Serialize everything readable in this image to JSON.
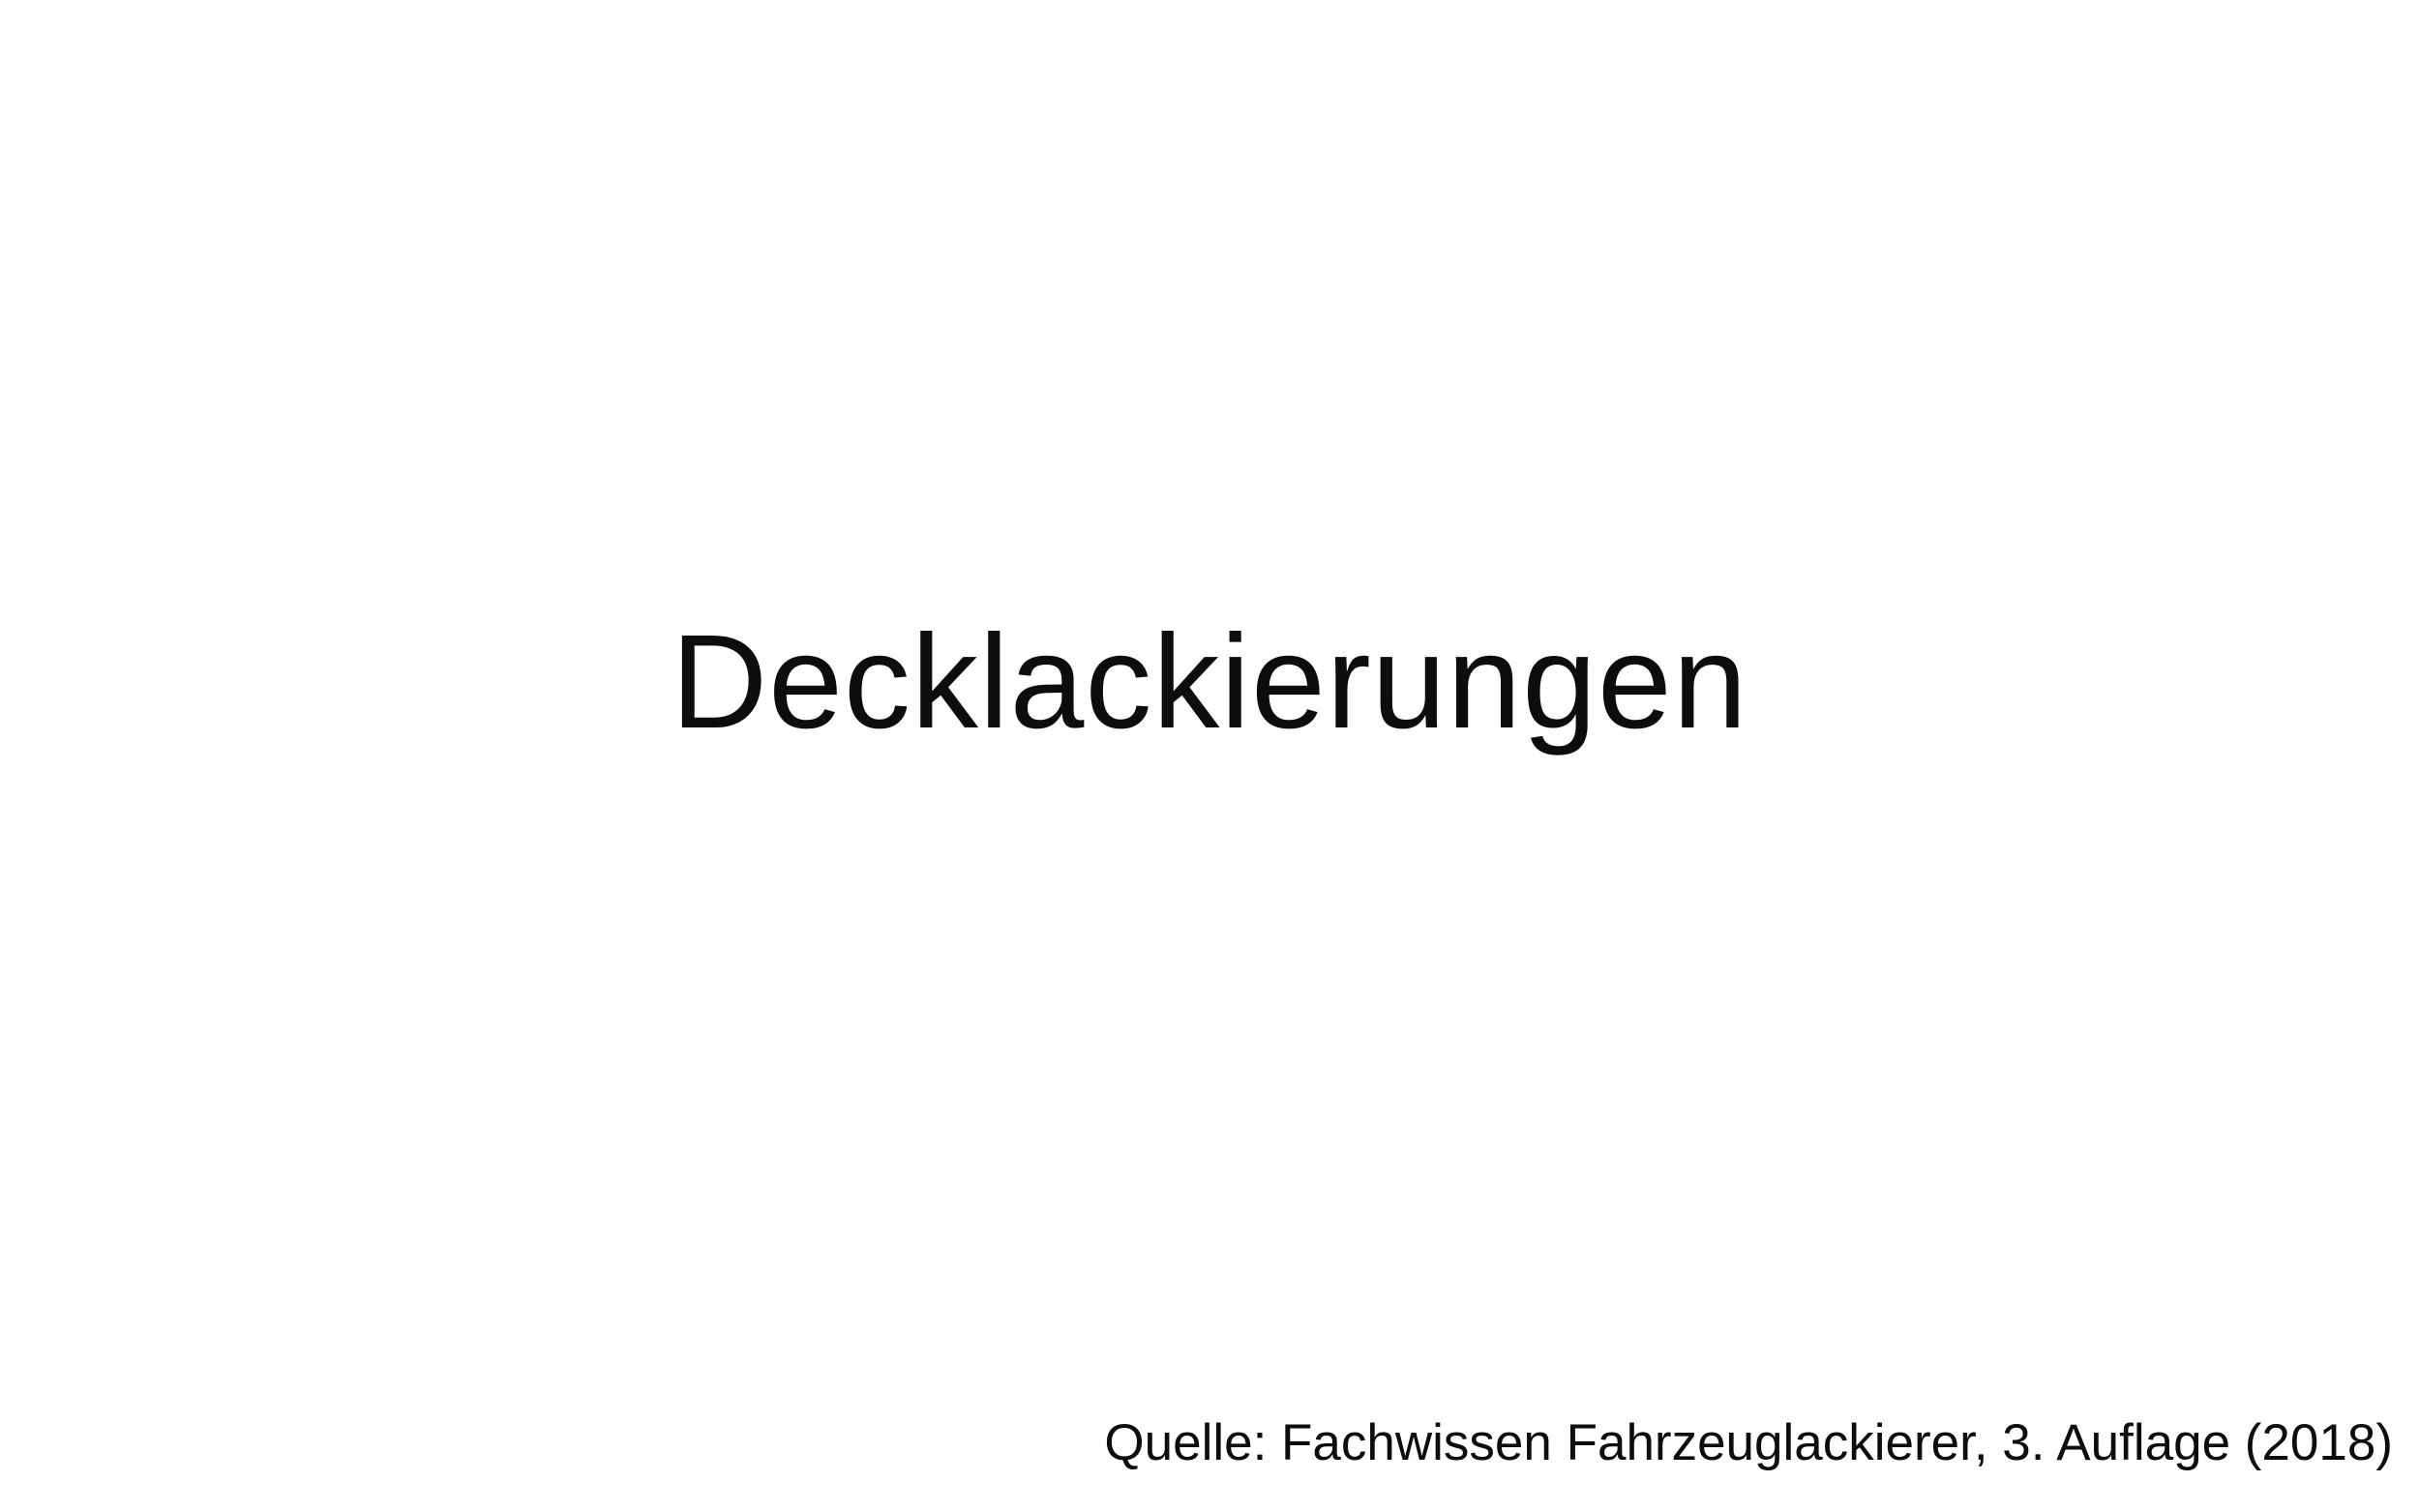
{
  "slide": {
    "title": "Decklackierungen",
    "source": "Quelle: Fachwissen Fahrzeuglackierer, 3. Auflage (2018)"
  },
  "colors": {
    "background": "#ffffff",
    "text": "#0d0d0d"
  }
}
